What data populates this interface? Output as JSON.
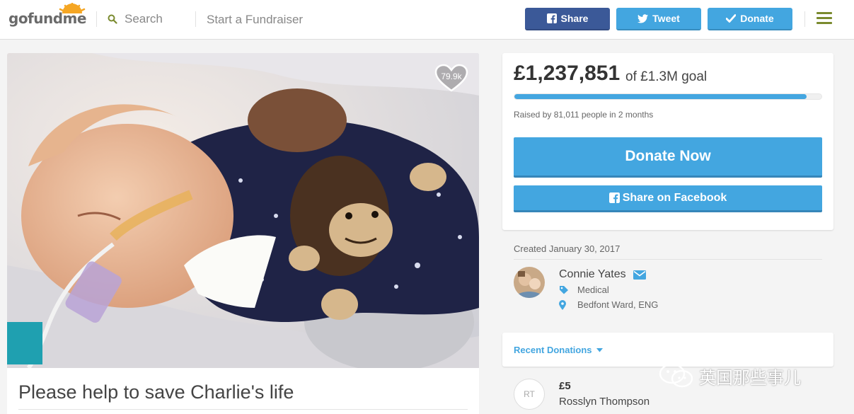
{
  "header": {
    "logo_text": "gofundme",
    "search_label": "Search",
    "start_label": "Start a Fundraiser",
    "share_label": "Share",
    "tweet_label": "Tweet",
    "donate_label": "Donate"
  },
  "campaign": {
    "title": "Please help to save Charlie's life",
    "likes": "79.9k",
    "raised": "£1,237,851",
    "goal_text": "of £1.3M goal",
    "progress_fraction": 0.952,
    "raised_by": "Raised by 81,011 people in 2 months",
    "donate_now": "Donate Now",
    "share_facebook": "Share on Facebook",
    "created": "Created January 30, 2017"
  },
  "organizer": {
    "name": "Connie Yates",
    "category": "Medical",
    "location": "Bedfont Ward, ENG"
  },
  "donations": {
    "label": "Recent Donations",
    "items": [
      {
        "initials": "RT",
        "amount": "£5",
        "name": "Rosslyn Thompson"
      }
    ]
  },
  "watermark": {
    "text": "英国那些事儿"
  },
  "colors": {
    "accent": "#43a6e0",
    "facebook": "#3b5998",
    "menu": "#7a8a2e"
  }
}
